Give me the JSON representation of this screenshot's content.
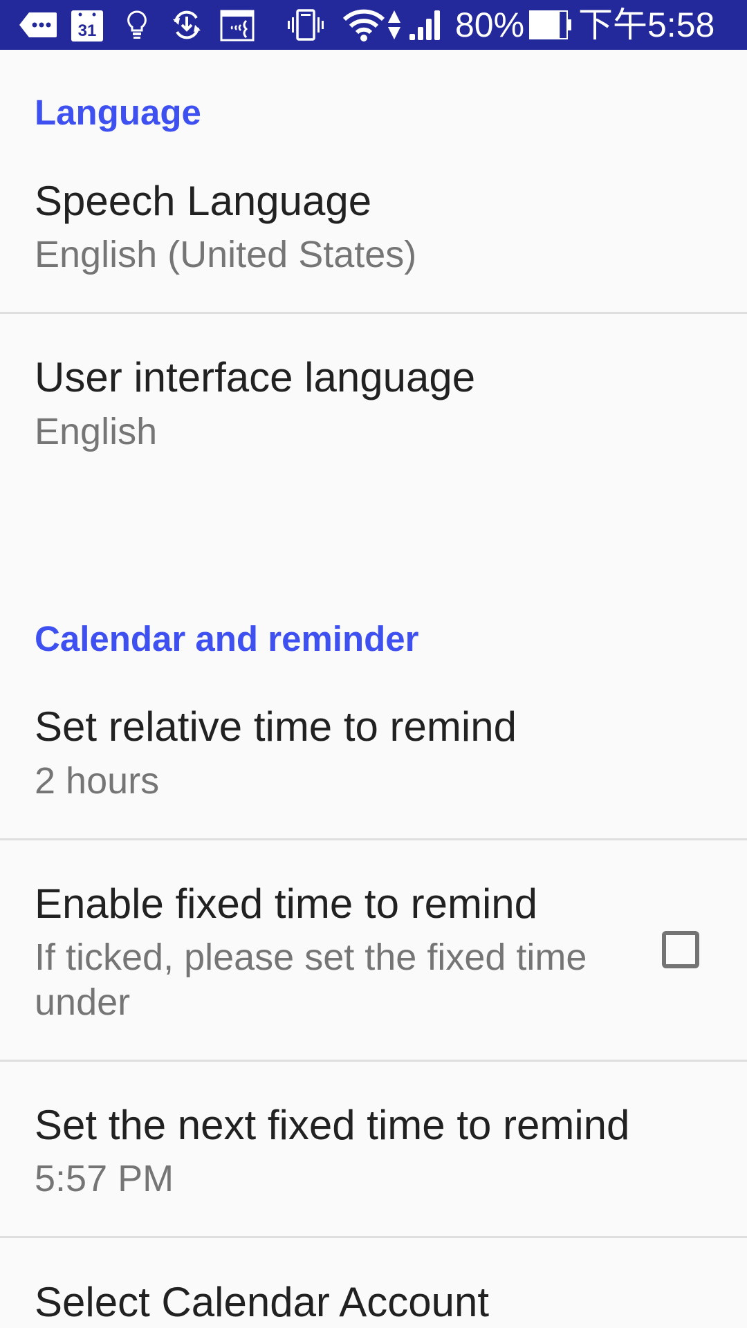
{
  "status_bar": {
    "icons": [
      "more-notifications-icon",
      "calendar-icon",
      "lightbulb-icon",
      "sync-download-icon",
      "voice-calendar-icon",
      "vibrate-icon",
      "wifi-icon",
      "data-arrows-icon",
      "signal-icon",
      "battery-icon"
    ],
    "calendar_day": "31",
    "battery_percent": "80%",
    "battery_level": 0.8,
    "time": "下午5:58"
  },
  "colors": {
    "status_bar": "#23289b",
    "section_header": "#3e50f0",
    "title": "#212121",
    "subtitle": "#757575",
    "background": "#fafafa"
  },
  "sections": [
    {
      "header": "Language",
      "items": [
        {
          "title": "Speech Language",
          "summary": "English (United States)"
        },
        {
          "title": "User interface language",
          "summary": "English"
        }
      ]
    },
    {
      "header": "Calendar and reminder",
      "items": [
        {
          "title": "Set relative time to remind",
          "summary": "2 hours"
        },
        {
          "title": "Enable fixed time to remind",
          "summary_line1": "If ticked, please set the fixed time",
          "summary_line2": "under",
          "checked": false
        },
        {
          "title": "Set the next fixed time to remind",
          "summary": "5:57 PM"
        },
        {
          "title": "Select Calendar Account"
        }
      ]
    }
  ]
}
